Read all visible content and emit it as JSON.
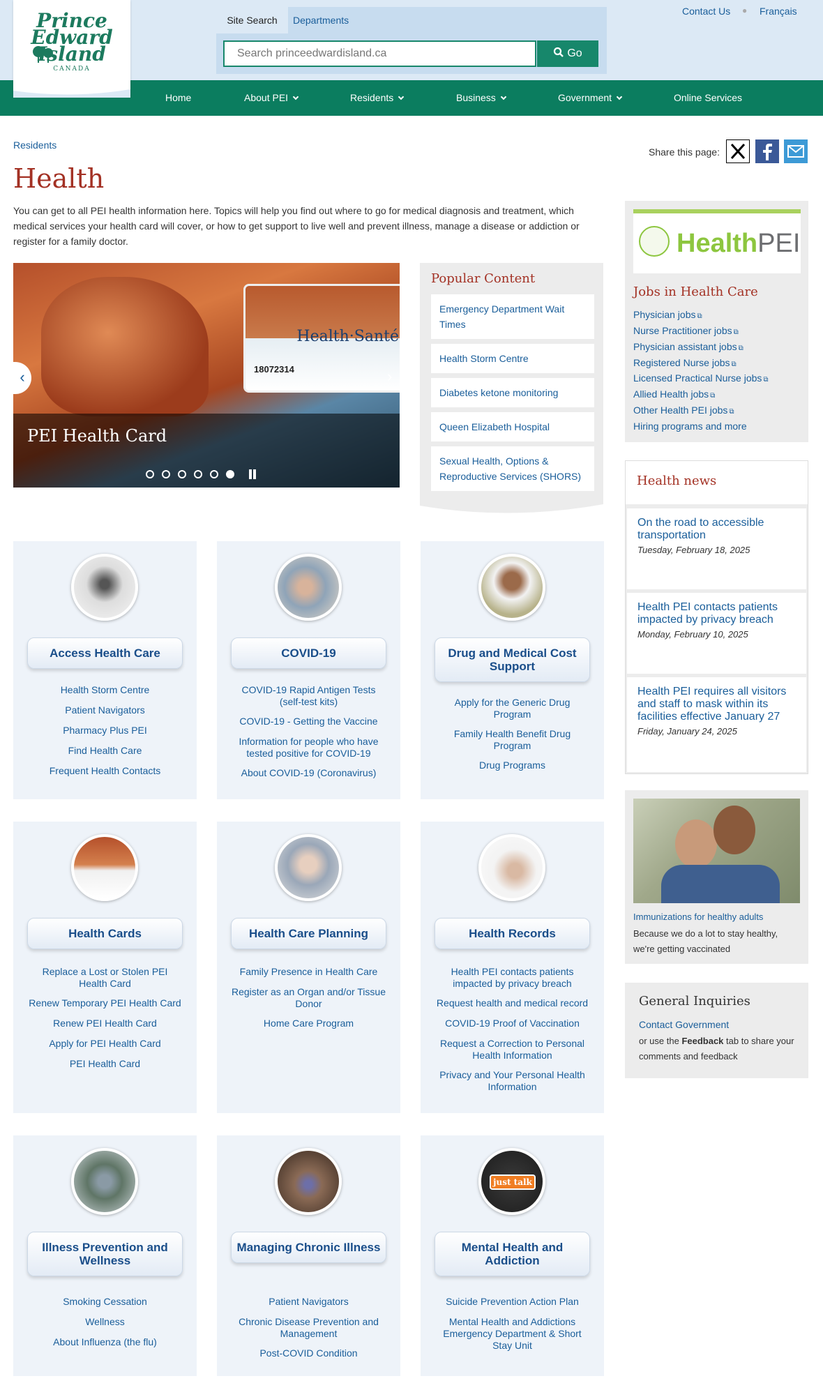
{
  "header": {
    "logo_line1": "Prince",
    "logo_line2": "Edward",
    "logo_line3": "Island",
    "logo_country": "CANADA",
    "util_links": [
      "Contact Us",
      "Français"
    ],
    "search_tabs": [
      "Site Search",
      "Departments"
    ],
    "search_placeholder": "Search princeedwardisland.ca",
    "search_button": "Go"
  },
  "nav": [
    "Home",
    "About PEI",
    "Residents",
    "Business",
    "Government",
    "Online Services"
  ],
  "breadcrumb": "Residents",
  "share_label": "Share this page:",
  "page_title": "Health",
  "intro": "You can get to all PEI health information here. Topics will help you find out where to go for medical diagnosis and treatment, which medical services your health card will cover, or how to get support to live well and prevent illness, manage a disease or addiction or register for a family doctor.",
  "carousel": {
    "caption": "PEI Health Card",
    "card_title": "Health·Santé",
    "card_number": "18072314",
    "slides": 6,
    "active_slide": 6
  },
  "popular": {
    "title": "Popular Content",
    "items": [
      "Emergency Department Wait Times",
      "Health Storm Centre",
      "Diabetes ketone monitoring",
      "Queen Elizabeth Hospital",
      "Sexual Health, Options & Reproductive Services (SHORS)"
    ]
  },
  "tiles": [
    {
      "title": "Access Health Care",
      "links": [
        "Health Storm Centre",
        "Patient Navigators",
        "Pharmacy Plus PEI",
        "Find Health Care",
        "Frequent Health Contacts"
      ]
    },
    {
      "title": "COVID-19",
      "links": [
        "COVID-19 Rapid Antigen Tests (self-test kits)",
        "COVID-19 - Getting the Vaccine",
        "Information for people who have tested positive for COVID-19",
        "About COVID-19 (Coronavirus)"
      ]
    },
    {
      "title": "Drug and Medical Cost Support",
      "links": [
        "Apply for the Generic Drug Program",
        "Family Health Benefit Drug Program",
        "Drug Programs"
      ]
    },
    {
      "title": "Health Cards",
      "links": [
        "Replace a Lost or Stolen PEI Health Card",
        "Renew Temporary PEI Health Card",
        "Renew PEI Health Card",
        "Apply for PEI Health Card",
        "PEI Health Card"
      ]
    },
    {
      "title": "Health Care Planning",
      "links": [
        "Family Presence in Health Care",
        "Register as an Organ and/or Tissue Donor",
        "Home Care Program"
      ]
    },
    {
      "title": "Health Records",
      "links": [
        "Health PEI contacts patients impacted by privacy breach",
        "Request health and medical record",
        "COVID-19 Proof of Vaccination",
        "Request a Correction to Personal Health Information",
        "Privacy and Your Personal Health Information"
      ]
    },
    {
      "title": "Illness Prevention and Wellness",
      "links": [
        "Smoking Cessation",
        "Wellness",
        "About Influenza (the flu)"
      ]
    },
    {
      "title": "Managing Chronic Illness",
      "links": [
        "Patient Navigators",
        "Chronic Disease Prevention and Management",
        "Post-COVID Condition"
      ]
    },
    {
      "title": "Mental Health and Addiction",
      "links": [
        "Suicide Prevention Action Plan",
        "Mental Health and Addictions Emergency Department & Short Stay Unit"
      ]
    }
  ],
  "just_talk": "just talk",
  "jobs": {
    "logo_a": "Health",
    "logo_b": "PEI",
    "title": "Jobs in Health Care",
    "items": [
      "Physician jobs",
      "Nurse Practitioner jobs",
      "Physician assistant jobs",
      "Registered Nurse jobs",
      "Licensed Practical Nurse jobs",
      "Allied Health jobs",
      "Other Health PEI jobs",
      "Hiring programs and more"
    ]
  },
  "news": {
    "title": "Health news",
    "items": [
      {
        "title": "On the road to accessible transportation",
        "date": "Tuesday, February 18, 2025"
      },
      {
        "title": "Health PEI contacts patients impacted by privacy breach",
        "date": "Monday, February 10, 2025"
      },
      {
        "title": "Health PEI requires all visitors and staff to mask within its facilities effective January 27",
        "date": "Friday, January 24, 2025"
      }
    ]
  },
  "immunization": {
    "link": "Immunizations for healthy adults",
    "text": "Because we do a lot to stay healthy, we're getting vaccinated"
  },
  "general": {
    "title": "General Inquiries",
    "link": "Contact Government",
    "text_pre": "or use the ",
    "text_bold": "Feedback",
    "text_post": " tab to share your comments and feedback"
  }
}
